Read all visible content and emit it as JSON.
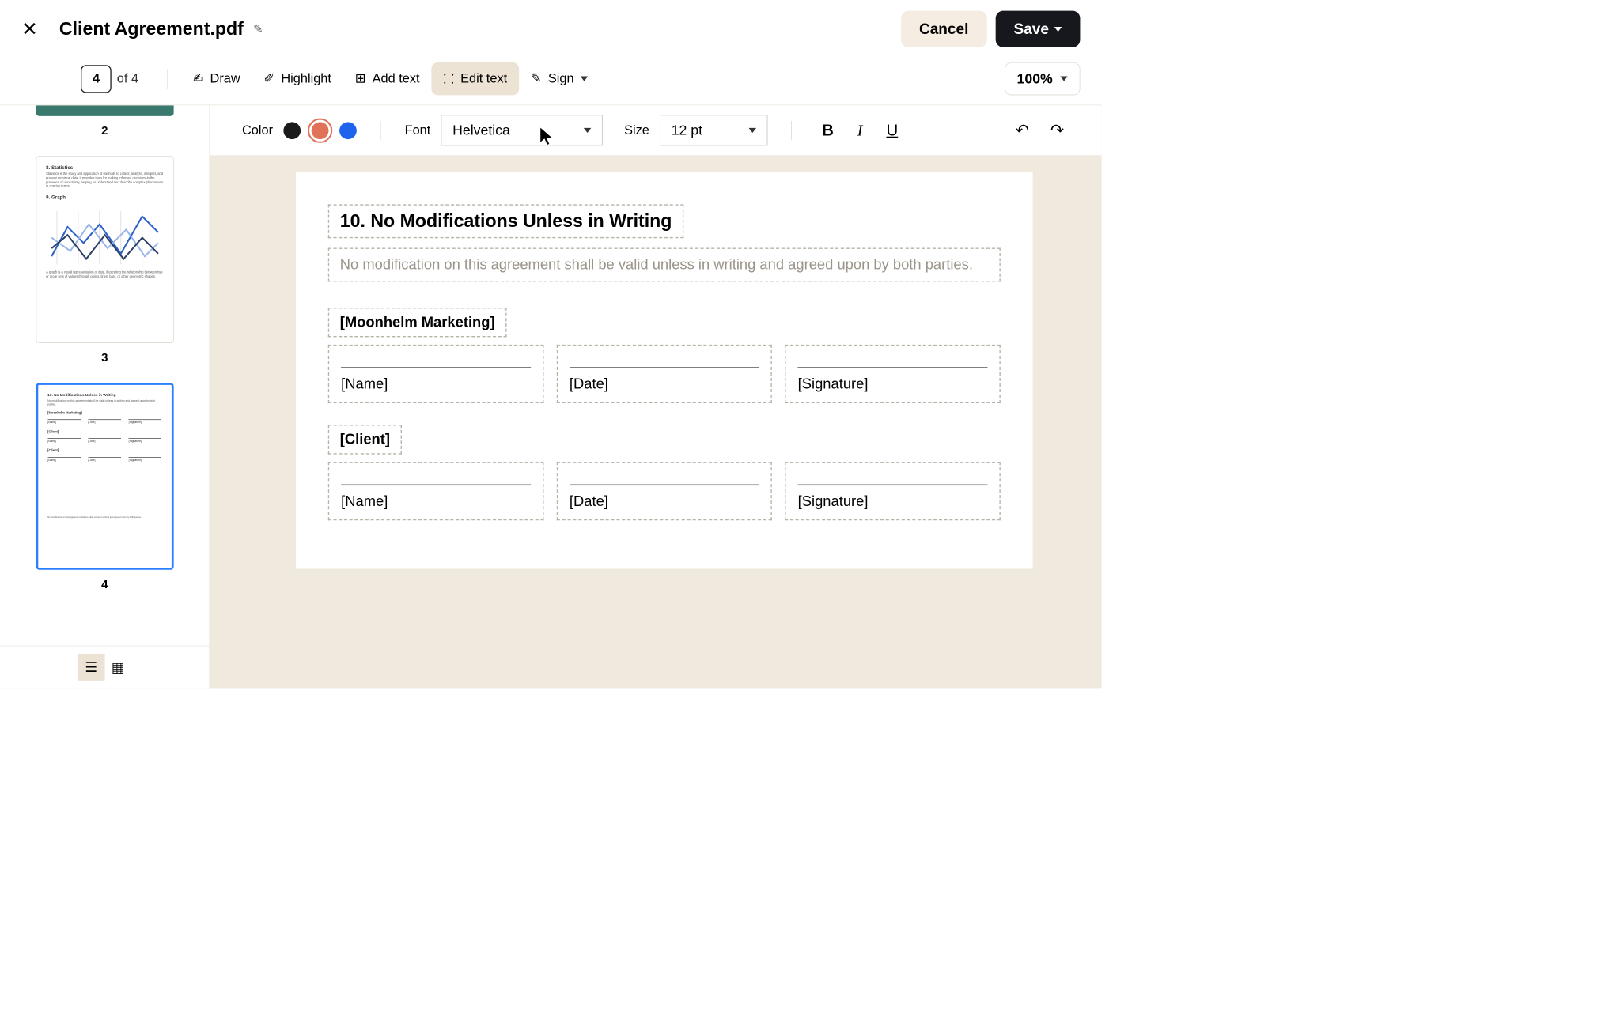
{
  "header": {
    "title": "Client Agreement.pdf",
    "cancel": "Cancel",
    "save": "Save"
  },
  "toolbar": {
    "page_current": "4",
    "page_total": "of 4",
    "draw": "Draw",
    "highlight": "Highlight",
    "add_text": "Add text",
    "edit_text": "Edit text",
    "sign": "Sign",
    "zoom": "100%"
  },
  "subtoolbar": {
    "color_label": "Color",
    "colors": {
      "black": "#1a1a1a",
      "orange": "#e0725a",
      "blue": "#1d63ed"
    },
    "selected_color": "orange",
    "font_label": "Font",
    "font_value": "Helvetica",
    "size_label": "Size",
    "size_value": "12 pt"
  },
  "thumbnails": {
    "p2_label": "2",
    "p3_label": "3",
    "p4_label": "4",
    "p3": {
      "h1": "8. Statistics",
      "t1": "Statistics is the study and application of methods to collect, analyze, interpret, and present empirical data. It provides tools for making informed decisions in the presence of uncertainty, helping us understand and describe complex phenomena in concise terms.",
      "h2": "9. Graph",
      "t2": "A graph is a visual representation of data, illustrating the relationship between two or more sets of values through points, lines, bars, or other geometric shapes."
    },
    "p4": {
      "h": "10. No Modifications Unless in Writing",
      "t": "No modification on this agreement shall be valid unless in writing and agreed upon by both parties.",
      "party1": "[Moonhelm Marketing]",
      "party2": "[Client]",
      "name": "[Name]",
      "date": "[Date]",
      "sig": "[Signature]",
      "foot": "No modification on this agreement shall be valid unless in writing and agreed upon by both parties."
    }
  },
  "document": {
    "heading": "10. No Modifications Unless in Writing",
    "body": "No modification on this agreement shall be valid unless in writing and agreed upon by both parties.",
    "party1": "[Moonhelm Marketing]",
    "party2": "[Client]",
    "field_name": "[Name]",
    "field_date": "[Date]",
    "field_signature": "[Signature]"
  }
}
